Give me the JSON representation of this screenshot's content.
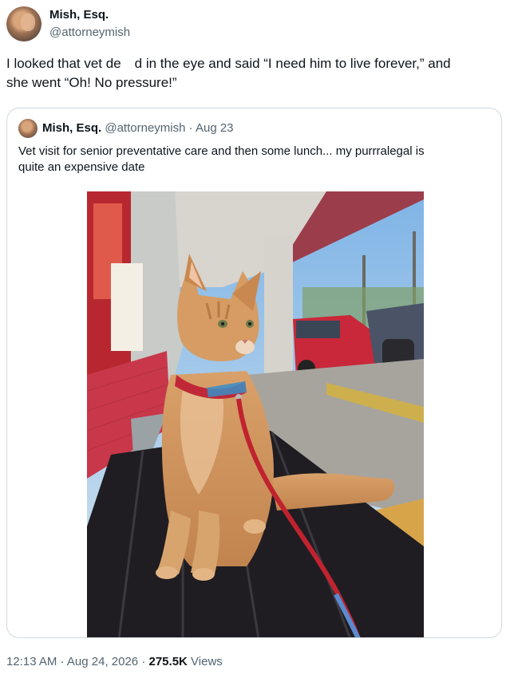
{
  "author": {
    "name": "Mish, Esq.",
    "handle": "@attorneymish"
  },
  "tweet": {
    "line1": "I looked that vet de d in the eye and said “I need him to live forever,” and",
    "line2": "she went “Oh! No pressure!”"
  },
  "quoted": {
    "name": "Mish, Esq.",
    "handle": "@attorneymish",
    "separator": "·",
    "date": "Aug 23",
    "line1": "Vet visit for senior preventative care and then some lunch... my purrralegal is",
    "line2": "quite an expensive date",
    "photo_icon": "cat-photo"
  },
  "footer": {
    "time": "12:13 AM",
    "separator": "·",
    "date": "Aug 24, 2026",
    "views_count": "275.5K",
    "views_label": "Views"
  }
}
